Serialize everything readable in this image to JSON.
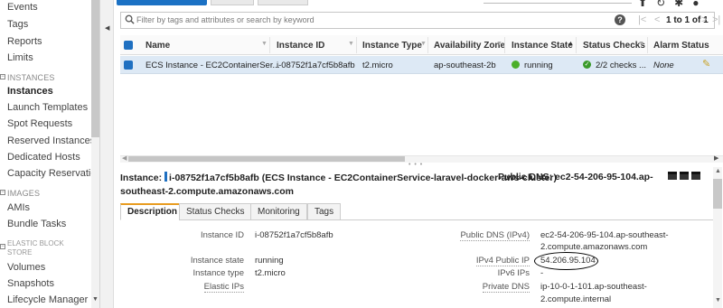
{
  "sidebar": {
    "items": [
      {
        "label": "Events"
      },
      {
        "label": "Tags"
      },
      {
        "label": "Reports"
      },
      {
        "label": "Limits"
      }
    ],
    "group_instances": "INSTANCES",
    "instances_items": [
      {
        "label": "Instances"
      },
      {
        "label": "Launch Templates"
      },
      {
        "label": "Spot Requests"
      },
      {
        "label": "Reserved Instances"
      },
      {
        "label": "Dedicated Hosts"
      },
      {
        "label": "Capacity Reservations"
      }
    ],
    "group_images": "IMAGES",
    "images_items": [
      {
        "label": "AMIs"
      },
      {
        "label": "Bundle Tasks"
      }
    ],
    "group_ebs_line1": "ELASTIC BLOCK",
    "group_ebs_line2": "STORE",
    "ebs_items": [
      {
        "label": "Volumes"
      },
      {
        "label": "Snapshots"
      },
      {
        "label": "Lifecycle Manager"
      }
    ]
  },
  "filter": {
    "placeholder": "Filter by tags and attributes or search by keyword",
    "pager": "1 to 1 of 1"
  },
  "table": {
    "columns": [
      "Name",
      "Instance ID",
      "Instance Type",
      "Availability Zone",
      "Instance State",
      "Status Checks",
      "Alarm Status"
    ],
    "row": {
      "name": "ECS Instance - EC2ContainerSer...",
      "instance_id": "i-08752f1a7cf5b8afb",
      "instance_type": "t2.micro",
      "az": "ap-southeast-2b",
      "state": "running",
      "status_checks": "2/2 checks ...",
      "alarm_status": "None"
    }
  },
  "detail": {
    "instance_label": "Instance:",
    "instance_id": "i-08752f1a7cf5b8afb",
    "instance_name": "(ECS Instance - EC2ContainerService-laravel-docker-aws-cluster)",
    "public_dns_label": "Public DNS:",
    "public_dns_value_line1": "ec2-54-206-95-104.ap-",
    "public_dns_value_line2": "southeast-2.compute.amazonaws.com",
    "tabs": [
      "Description",
      "Status Checks",
      "Monitoring",
      "Tags"
    ],
    "fields_left": [
      {
        "label": "Instance ID",
        "value": "i-08752f1a7cf5b8afb"
      },
      {
        "label": "Instance state",
        "value": "running"
      },
      {
        "label": "Instance type",
        "value": "t2.micro"
      },
      {
        "label": "Elastic IPs",
        "value": ""
      }
    ],
    "fields_right": {
      "public_dns_label": "Public DNS (IPv4)",
      "public_dns_line1": "ec2-54-206-95-104.ap-southeast-",
      "public_dns_line2": "2.compute.amazonaws.com",
      "ipv4_label": "IPv4 Public IP",
      "ipv4_value": "54.206.95.104",
      "ipv6_label": "IPv6 IPs",
      "ipv6_value": "-",
      "private_dns_label": "Private DNS",
      "private_dns_line1": "ip-10-0-1-101.ap-southeast-",
      "private_dns_line2": "2.compute.internal"
    }
  },
  "colors": {
    "accent_blue": "#1f70c1",
    "tab_active_border": "#e89c20",
    "running_green": "#4caf2a",
    "selected_row": "#dde9f5"
  }
}
